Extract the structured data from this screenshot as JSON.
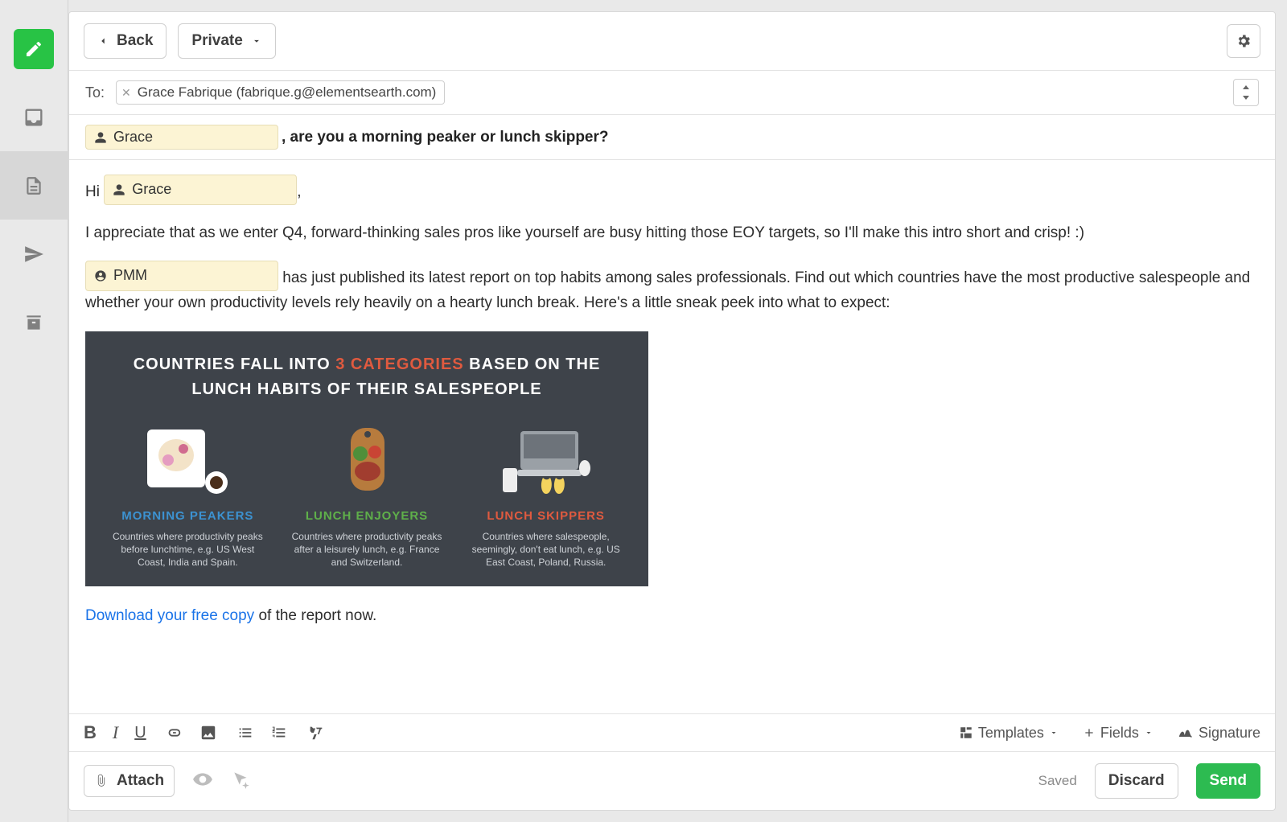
{
  "rail": {
    "compose": "Compose"
  },
  "toolbar": {
    "back": "Back",
    "visibility": "Private"
  },
  "to": {
    "label": "To:",
    "recipient": "Grace Fabrique (fabrique.g@elementsearth.com)"
  },
  "subject": {
    "token": "Grace",
    "rest": ", are you a morning peaker or lunch skipper?"
  },
  "body": {
    "greeting_prefix": "Hi",
    "greeting_token": "Grace",
    "greeting_suffix": ",",
    "p1": "I appreciate that as we enter Q4, forward-thinking sales pros like yourself are busy hitting those EOY targets, so I'll make this intro short and crisp! :)",
    "p2_token": "PMM",
    "p2_rest": " has just published its latest report on top habits among sales professionals. Find out which countries have the most productive salespeople and whether your own productivity levels rely heavily on a hearty lunch break. Here's a little sneak peek into what to expect:",
    "download_link": "Download your free copy",
    "download_rest": " of the report now."
  },
  "infographic": {
    "title_a": "Countries fall into ",
    "title_b": "3 categories",
    "title_c": " based on the lunch habits of their salespeople",
    "cols": [
      {
        "name": "MORNING PEAKERS",
        "color": "blue",
        "desc": "Countries where productivity peaks before lunchtime, e.g. US West Coast, India and Spain."
      },
      {
        "name": "LUNCH ENJOYERS",
        "color": "green",
        "desc": "Countries where productivity peaks after a leisurely lunch, e.g. France and Switzerland."
      },
      {
        "name": "LUNCH SKIPPERS",
        "color": "red",
        "desc": "Countries where salespeople, seemingly, don't eat lunch, e.g. US East Coast, Poland, Russia."
      }
    ]
  },
  "fmt": {
    "templates": "Templates",
    "fields": "Fields",
    "signature": "Signature"
  },
  "actions": {
    "attach": "Attach",
    "saved": "Saved",
    "discard": "Discard",
    "send": "Send"
  }
}
